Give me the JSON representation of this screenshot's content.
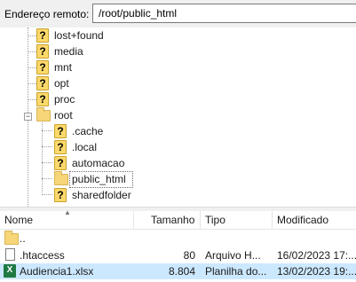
{
  "address_bar": {
    "label": "Endereço remoto:",
    "value": "/root/public_html"
  },
  "tree": {
    "items": [
      {
        "label": "lost+found",
        "icon": "unknown-folder-icon"
      },
      {
        "label": "media",
        "icon": "unknown-folder-icon"
      },
      {
        "label": "mnt",
        "icon": "unknown-folder-icon"
      },
      {
        "label": "opt",
        "icon": "unknown-folder-icon"
      },
      {
        "label": "proc",
        "icon": "unknown-folder-icon"
      },
      {
        "label": "root",
        "icon": "folder-icon",
        "expanded": true
      },
      {
        "label": ".cache",
        "icon": "unknown-folder-icon"
      },
      {
        "label": ".local",
        "icon": "unknown-folder-icon"
      },
      {
        "label": "automacao",
        "icon": "unknown-folder-icon"
      },
      {
        "label": "public_html",
        "icon": "folder-icon",
        "selected": true
      },
      {
        "label": "sharedfolder",
        "icon": "unknown-folder-icon"
      }
    ],
    "unknown_glyph": "?"
  },
  "list": {
    "columns": {
      "name": "Nome",
      "size": "Tamanho",
      "type": "Tipo",
      "modified": "Modificado"
    },
    "rows": [
      {
        "name": "..",
        "size": "",
        "type": "",
        "modified": "",
        "icon": "folder-icon"
      },
      {
        "name": ".htaccess",
        "size": "80",
        "type": "Arquivo H...",
        "modified": "16/02/2023 17:...",
        "icon": "file-icon"
      },
      {
        "name": "Audiencia1.xlsx",
        "size": "8.804",
        "type": "Planilha do...",
        "modified": "13/02/2023 19:...",
        "icon": "excel-icon",
        "selected": true
      }
    ]
  },
  "colors": {
    "selection": "#cce8ff",
    "folder": "#f7d67a",
    "excel": "#1f7a43"
  },
  "excel_glyph": "X"
}
